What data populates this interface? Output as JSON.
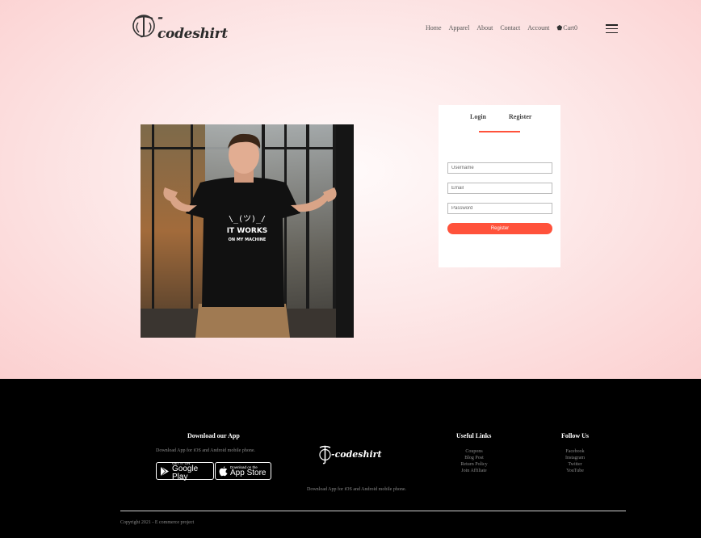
{
  "header": {
    "logo_text": "-codeshirt",
    "nav": [
      "Home",
      "Apparel",
      "About",
      "Contact",
      "Account"
    ],
    "cart_label": "Cart0"
  },
  "form": {
    "tabs": [
      "Login",
      "Register"
    ],
    "active_tab": "Register",
    "username_placeholder": "Username",
    "email_placeholder": "Email",
    "password_placeholder": "Password",
    "submit_label": "Register"
  },
  "photo": {
    "shirt_line1": "\\_(ツ)_/",
    "shirt_line2": "IT WORKS",
    "shirt_line3": "ON MY MACHINE"
  },
  "footer": {
    "download_title": "Download our App",
    "download_desc": "Download App for iOS and Android mobile phone.",
    "google_play_small": "GET IT ON",
    "google_play_big": "Google Play",
    "app_store_small": "Download on the",
    "app_store_big": "App Store",
    "logo_text": "-codeshirt",
    "center_desc": "Download App for iOS and Android mobile phone.",
    "useful_links_title": "Useful Links",
    "useful_links": [
      "Coupons",
      "Blog Post",
      "Return Policy",
      "Join Affiliate"
    ],
    "follow_title": "Follow Us",
    "follow_links": [
      "Facebook",
      "Instagram",
      "Twitter",
      "YouTube"
    ],
    "copyright": "Copyright 2021 - E commerce project"
  },
  "colors": {
    "accent": "#ff523b",
    "hero_bg": "#fbd8d8",
    "footer_bg": "#000000"
  }
}
